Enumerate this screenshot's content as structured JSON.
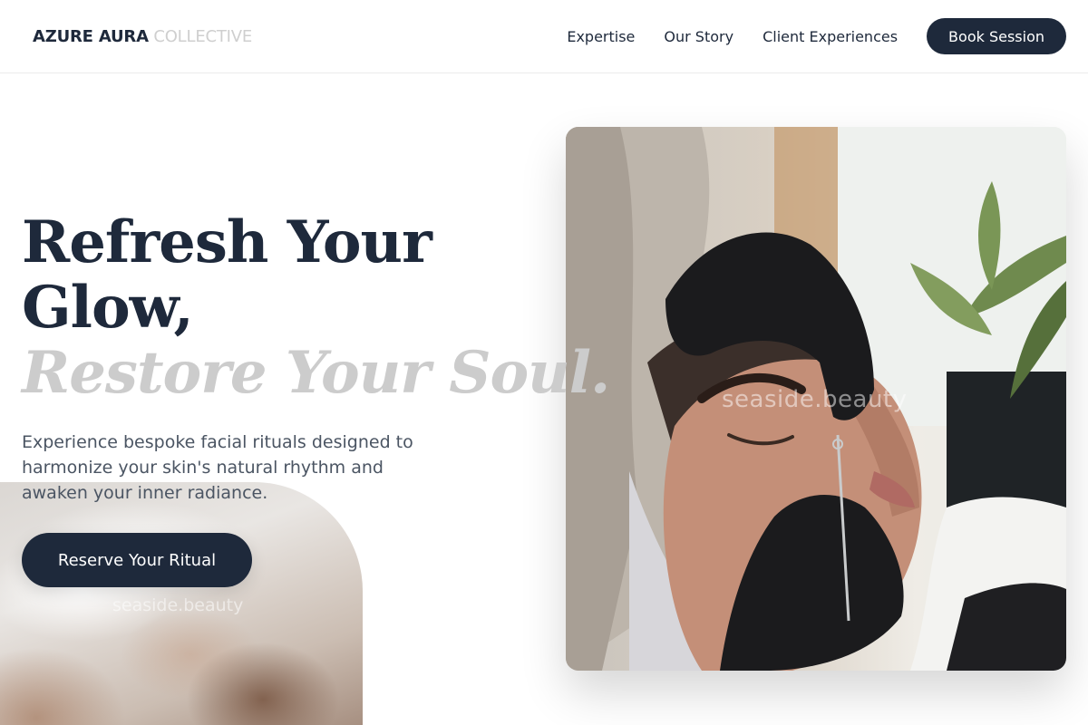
{
  "nav": {
    "logo_bold": "AZURE AURA",
    "logo_light": "COLLECTIVE",
    "links": [
      "Expertise",
      "Our Story",
      "Client Experiences"
    ],
    "book_label": "Book Session"
  },
  "hero": {
    "headline_line1": "Refresh Your",
    "headline_line2": "Glow,",
    "headline_accent": "Restore Your Soul.",
    "lead": "Experience bespoke facial rituals designed to harmonize your skin's natural rhythm and awaken your inner radiance.",
    "cta_label": "Reserve Your Ritual"
  },
  "images": {
    "main_watermark": "seaside.beauty",
    "secondary_watermark": "seaside.beauty"
  },
  "colors": {
    "primary": "#1e293b",
    "accent_text": "#cccccc",
    "body_text": "#4b5563"
  }
}
